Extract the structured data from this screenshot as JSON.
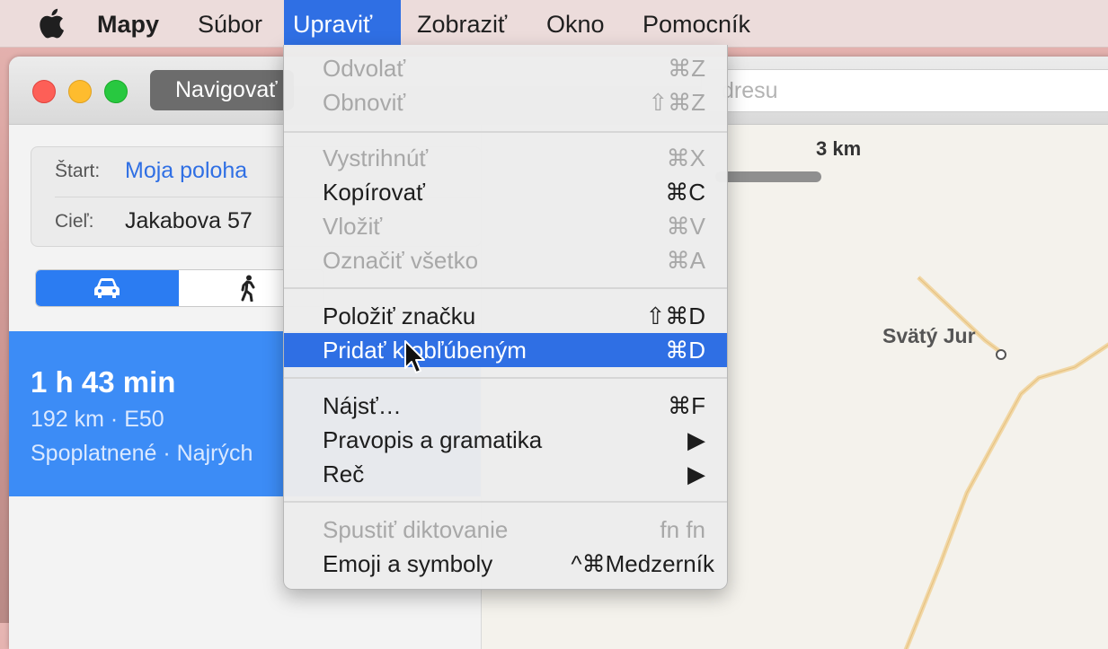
{
  "menubar": {
    "app_name": "Mapy",
    "items": [
      "Súbor",
      "Upraviť",
      "Zobraziť",
      "Okno",
      "Pomocník"
    ],
    "active": "Upraviť"
  },
  "window": {
    "nav_button": "Navigovať",
    "search_placeholder": "dresu"
  },
  "route": {
    "start_label": "Štart:",
    "start_value": "Moja poloha",
    "dest_label": "Cieľ:",
    "dest_value": "Jakabova 57"
  },
  "result": {
    "time": "1 h 43 min",
    "distance": "192 km · E50",
    "detail": "Spoplatnené · Najrých"
  },
  "map": {
    "scale_label": "3 km",
    "town_label": "Svätý Jur"
  },
  "menu": {
    "items": [
      {
        "label": "Odvolať",
        "shortcut": "⌘Z",
        "state": "disabled"
      },
      {
        "label": "Obnoviť",
        "shortcut": "⇧⌘Z",
        "state": "disabled"
      },
      {
        "label": "Vystrihnúť",
        "shortcut": "⌘X",
        "state": "disabled"
      },
      {
        "label": "Kopírovať",
        "shortcut": "⌘C",
        "state": "enabled"
      },
      {
        "label": "Vložiť",
        "shortcut": "⌘V",
        "state": "disabled"
      },
      {
        "label": "Označiť všetko",
        "shortcut": "⌘A",
        "state": "disabled"
      },
      {
        "label": "Položiť značku",
        "shortcut": "⇧⌘D",
        "state": "enabled"
      },
      {
        "label": "Pridať k obľúbeným",
        "shortcut": "⌘D",
        "state": "highlighted"
      },
      {
        "label": "Nájsť…",
        "shortcut": "⌘F",
        "state": "enabled"
      },
      {
        "label": "Pravopis a gramatika",
        "shortcut": "▶",
        "state": "enabled"
      },
      {
        "label": "Reč",
        "shortcut": "▶",
        "state": "enabled"
      },
      {
        "label": "Spustiť diktovanie",
        "shortcut": "fn fn",
        "state": "disabled"
      },
      {
        "label": "Emoji a symboly",
        "shortcut": "^⌘Medzerník",
        "state": "enabled"
      }
    ]
  },
  "colors": {
    "accent": "#2f6fe4",
    "route_card": "#3c8cf6",
    "link": "#2f6fe4"
  }
}
